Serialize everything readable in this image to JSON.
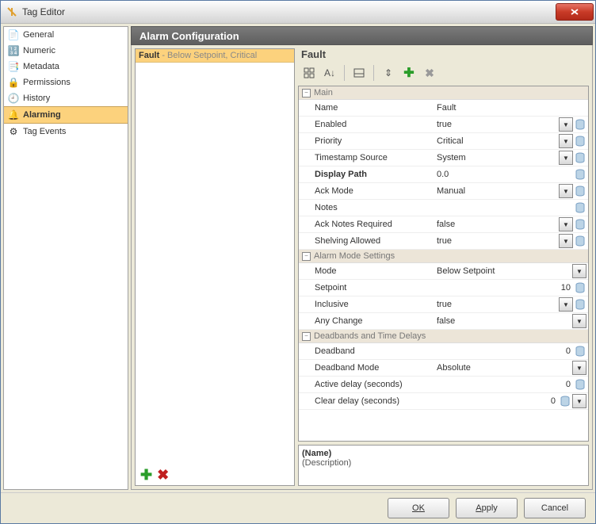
{
  "window": {
    "title": "Tag Editor",
    "close": "X"
  },
  "sidebar": {
    "items": [
      {
        "label": "General",
        "icon": "📄"
      },
      {
        "label": "Numeric",
        "icon": "🔢"
      },
      {
        "label": "Metadata",
        "icon": "📑"
      },
      {
        "label": "Permissions",
        "icon": "🔒"
      },
      {
        "label": "History",
        "icon": "🕘"
      },
      {
        "label": "Alarming",
        "icon": "🔔"
      },
      {
        "label": "Tag Events",
        "icon": "⚙"
      }
    ],
    "selected_index": 5
  },
  "main": {
    "header": "Alarm Configuration",
    "alarm_list": [
      {
        "name": "Fault",
        "suffix": " - Below Setpoint, Critical"
      }
    ],
    "detail": {
      "title": "Fault",
      "groups": [
        {
          "name": "Main",
          "rows": [
            {
              "name": "Name",
              "value": "Fault",
              "ctrls": []
            },
            {
              "name": "Enabled",
              "value": "true",
              "ctrls": [
                "dd",
                "db"
              ]
            },
            {
              "name": "Priority",
              "value": "Critical",
              "ctrls": [
                "dd",
                "db"
              ]
            },
            {
              "name": "Timestamp Source",
              "value": "System",
              "ctrls": [
                "dd",
                "db"
              ]
            },
            {
              "name": "Display Path",
              "value": "0.0",
              "ctrls": [
                "db"
              ],
              "bold": true
            },
            {
              "name": "Ack Mode",
              "value": "Manual",
              "ctrls": [
                "dd",
                "db"
              ]
            },
            {
              "name": "Notes",
              "value": "",
              "ctrls": [
                "db"
              ]
            },
            {
              "name": "Ack Notes Required",
              "value": "false",
              "ctrls": [
                "dd",
                "db"
              ]
            },
            {
              "name": "Shelving Allowed",
              "value": "true",
              "ctrls": [
                "dd",
                "db"
              ]
            }
          ]
        },
        {
          "name": "Alarm Mode Settings",
          "rows": [
            {
              "name": "Mode",
              "value": "Below Setpoint",
              "ctrls": [
                "dd"
              ]
            },
            {
              "name": "Setpoint",
              "value": "10",
              "ctrls": [
                "db"
              ],
              "right": true
            },
            {
              "name": "Inclusive",
              "value": "true",
              "ctrls": [
                "dd",
                "db"
              ]
            },
            {
              "name": "Any Change",
              "value": "false",
              "ctrls": [
                "dd"
              ]
            }
          ]
        },
        {
          "name": "Deadbands and Time Delays",
          "rows": [
            {
              "name": "Deadband",
              "value": "0",
              "ctrls": [
                "db"
              ],
              "right": true
            },
            {
              "name": "Deadband Mode",
              "value": "Absolute",
              "ctrls": [
                "dd"
              ]
            },
            {
              "name": "Active delay (seconds)",
              "value": "0",
              "ctrls": [
                "db"
              ],
              "right": true
            },
            {
              "name": "Clear delay (seconds)",
              "value": "0",
              "ctrls": [
                "db",
                "dd"
              ],
              "right": true
            }
          ]
        }
      ],
      "desc_name": "(Name)",
      "desc_text": "(Description)"
    }
  },
  "footer": {
    "ok": "OK",
    "apply": "Apply",
    "cancel": "Cancel"
  }
}
